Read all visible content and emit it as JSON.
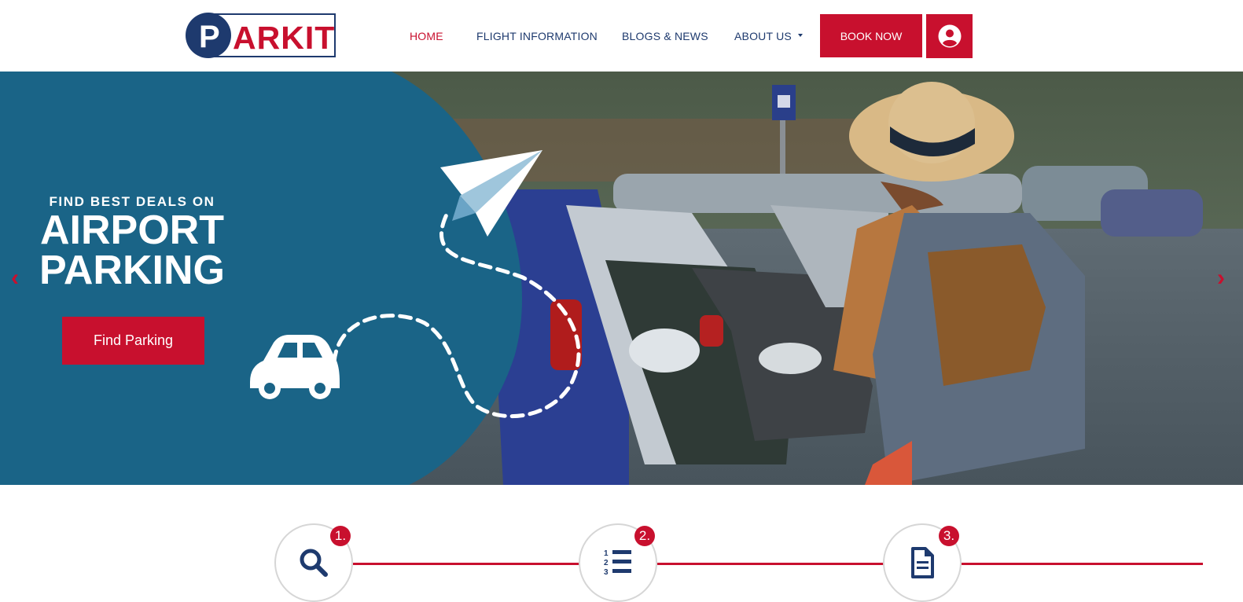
{
  "brand": {
    "logo_initial": "P",
    "logo_text": "ARKIT"
  },
  "nav": {
    "items": [
      {
        "label": "HOME",
        "active": true
      },
      {
        "label": "FLIGHT INFORMATION",
        "active": false
      },
      {
        "label": "BLOGS & NEWS",
        "active": false
      },
      {
        "label": "ABOUT US",
        "active": false,
        "has_dropdown": true
      }
    ],
    "book_label": "BOOK NOW",
    "account_icon": "user-circle-icon"
  },
  "hero": {
    "tagline": "FIND BEST DEALS ON",
    "title_line1": "AIRPORT",
    "title_line2": "PARKING",
    "cta_label": "Find Parking",
    "prev_glyph": "‹",
    "next_glyph": "›"
  },
  "steps": [
    {
      "number": "1.",
      "icon": "search-icon"
    },
    {
      "number": "2.",
      "icon": "numbered-list-icon"
    },
    {
      "number": "3.",
      "icon": "document-icon"
    }
  ],
  "colors": {
    "accent": "#c8102e",
    "navy": "#1e3a6e",
    "hero_panel": "#1a6487"
  }
}
